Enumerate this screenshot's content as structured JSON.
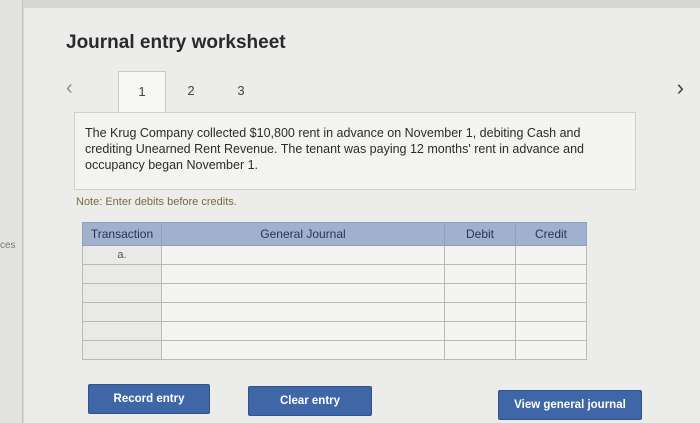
{
  "sidebar": {
    "cut_text": "ces"
  },
  "worksheet": {
    "title": "Journal entry worksheet",
    "tabs": [
      "1",
      "2",
      "3"
    ],
    "prev_icon": "chevron-left-icon",
    "next_icon": "chevron-right-icon",
    "question": "The Krug Company collected $10,800 rent in advance on November 1, debiting Cash and crediting Unearned Rent Revenue. The tenant was paying 12 months' rent in advance and occupancy began November 1.",
    "note": "Note: Enter debits before credits."
  },
  "journal_table": {
    "columns": [
      "Transaction",
      "General Journal",
      "Debit",
      "Credit"
    ],
    "rows": [
      {
        "transaction": "a.",
        "account": "",
        "debit": "",
        "credit": ""
      },
      {
        "transaction": "",
        "account": "",
        "debit": "",
        "credit": ""
      },
      {
        "transaction": "",
        "account": "",
        "debit": "",
        "credit": ""
      },
      {
        "transaction": "",
        "account": "",
        "debit": "",
        "credit": ""
      },
      {
        "transaction": "",
        "account": "",
        "debit": "",
        "credit": ""
      },
      {
        "transaction": "",
        "account": "",
        "debit": "",
        "credit": ""
      }
    ]
  },
  "buttons": {
    "record": "Record entry",
    "clear": "Clear entry",
    "view_journal": "View general journal"
  },
  "colors": {
    "header": "#9fb1cc",
    "button": "#3f67a8"
  }
}
